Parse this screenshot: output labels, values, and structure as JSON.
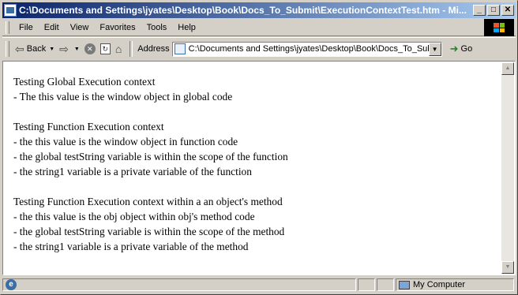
{
  "window": {
    "title": "C:\\Documents and Settings\\jyates\\Desktop\\Book\\Docs_To_Submit\\ExecutionContextTest.htm - Mi...",
    "minimize_glyph": "_",
    "maximize_glyph": "□",
    "close_glyph": "✕"
  },
  "menu": {
    "items": [
      {
        "label": "File"
      },
      {
        "label": "Edit"
      },
      {
        "label": "View"
      },
      {
        "label": "Favorites"
      },
      {
        "label": "Tools"
      },
      {
        "label": "Help"
      }
    ]
  },
  "toolbar": {
    "back_label": "Back",
    "back_icon": "arrow-left-icon",
    "forward_icon": "arrow-right-icon",
    "stop_icon": "stop-icon",
    "refresh_icon": "refresh-icon",
    "home_icon": "home-icon",
    "address_label": "Address",
    "address_value": "C:\\Documents and Settings\\jyates\\Desktop\\Book\\Docs_To_Submit\\ExecutionContextTest.htm",
    "go_label": "Go"
  },
  "content": {
    "lines": [
      "Testing Global Execution context",
      "- The this value is the window object in global code",
      "",
      "Testing Function Execution context",
      "- the this value is the window object in function code",
      "- the global testString variable is within the scope of the function",
      "- the string1 variable is a private variable of the function",
      "",
      "Testing Function Execution context within a an object's method",
      "- the this value is the obj object within obj's method code",
      "- the global testString variable is within the scope of the method",
      "- the string1 variable is a private variable of the method"
    ]
  },
  "statusbar": {
    "zone_label": "My Computer"
  },
  "colors": {
    "titlebar_start": "#0a246a",
    "titlebar_end": "#a6caf0",
    "chrome": "#d4d0c8"
  }
}
